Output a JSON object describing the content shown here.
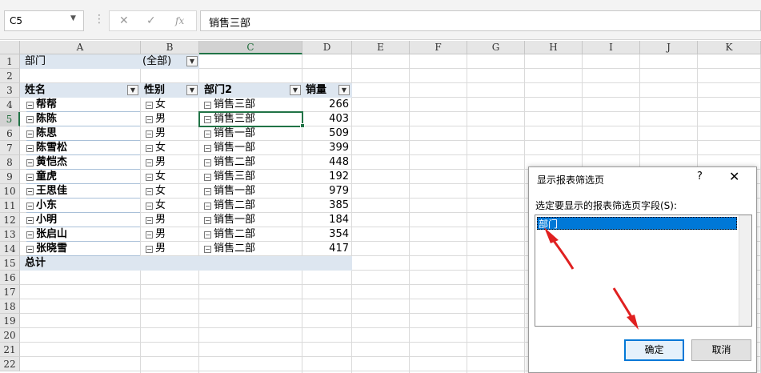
{
  "formula_bar": {
    "name_box": "C5",
    "cancel_glyph": "✕",
    "enter_glyph": "✓",
    "function_glyph": "fx",
    "formula_value": "销售三部"
  },
  "columns": [
    "A",
    "B",
    "C",
    "D",
    "E",
    "F",
    "G",
    "H",
    "I",
    "J",
    "K"
  ],
  "rows": [
    "1",
    "2",
    "3",
    "4",
    "5",
    "6",
    "7",
    "8",
    "9",
    "10",
    "11",
    "12",
    "13",
    "14",
    "15",
    "16",
    "17",
    "18",
    "19",
    "20",
    "21",
    "22"
  ],
  "pivot": {
    "filter_label": "部门",
    "filter_value": "(全部)",
    "headers": [
      "姓名",
      "性别",
      "部门2",
      "销量"
    ],
    "data": [
      {
        "name": "帮帮",
        "gender": "女",
        "dept": "销售三部",
        "sales": "266"
      },
      {
        "name": "陈陈",
        "gender": "男",
        "dept": "销售三部",
        "sales": "403"
      },
      {
        "name": "陈思",
        "gender": "男",
        "dept": "销售一部",
        "sales": "509"
      },
      {
        "name": "陈雪松",
        "gender": "女",
        "dept": "销售一部",
        "sales": "399"
      },
      {
        "name": "黄恺杰",
        "gender": "男",
        "dept": "销售二部",
        "sales": "448"
      },
      {
        "name": "童虎",
        "gender": "女",
        "dept": "销售三部",
        "sales": "192"
      },
      {
        "name": "王思佳",
        "gender": "女",
        "dept": "销售一部",
        "sales": "979"
      },
      {
        "name": "小东",
        "gender": "女",
        "dept": "销售二部",
        "sales": "385"
      },
      {
        "name": "小明",
        "gender": "男",
        "dept": "销售一部",
        "sales": "184"
      },
      {
        "name": "张启山",
        "gender": "男",
        "dept": "销售二部",
        "sales": "354"
      },
      {
        "name": "张晓雪",
        "gender": "男",
        "dept": "销售二部",
        "sales": "417"
      }
    ],
    "total_label": "总计"
  },
  "dialog": {
    "title": "显示报表筛选页",
    "help": "?",
    "close": "✕",
    "field_label": "选定要显示的报表筛选页字段(S):",
    "items": [
      "部门"
    ],
    "ok_label": "确定",
    "cancel_label": "取消"
  },
  "colors": {
    "selection_green": "#217346",
    "pivot_header_band": "#dde6f0",
    "list_highlight": "#0078d7",
    "annotation_arrow": "#e02020"
  }
}
